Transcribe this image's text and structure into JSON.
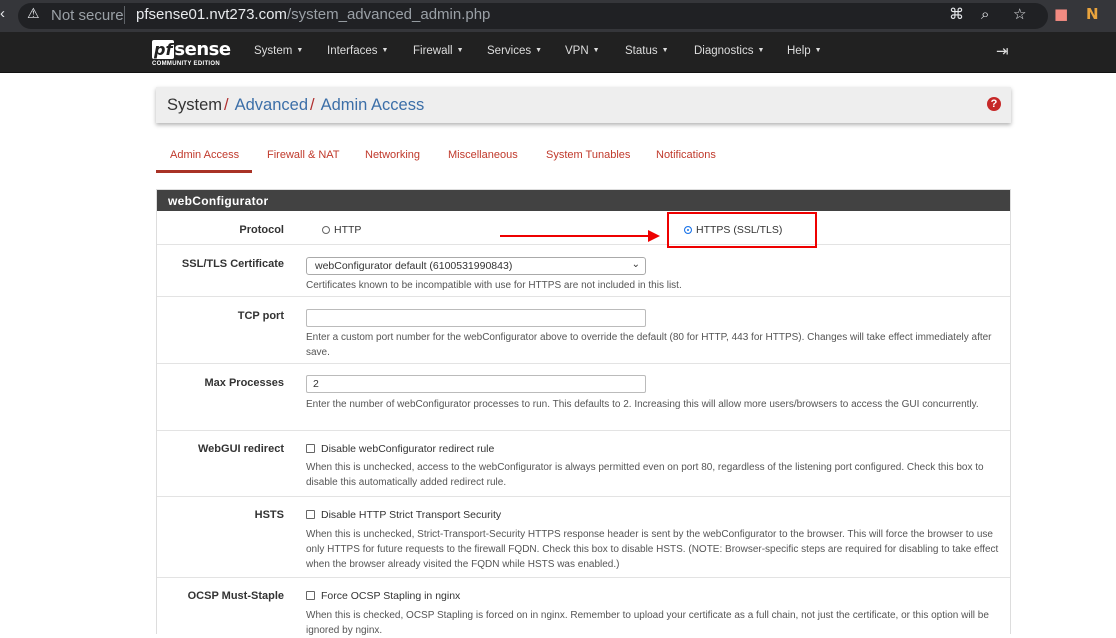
{
  "browser": {
    "security": "Not secure",
    "host": "pfsense01.nvt273.com",
    "path": "/system_advanced_admin.php"
  },
  "brand": {
    "pf": "pf",
    "sense": "sense",
    "edition": "COMMUNITY EDITION"
  },
  "nav": {
    "items": [
      "System",
      "Interfaces",
      "Firewall",
      "Services",
      "VPN",
      "Status",
      "Diagnostics",
      "Help"
    ]
  },
  "breadcrumb": {
    "root": "System",
    "sep": "/",
    "mid": "Advanced",
    "leaf": "Admin Access",
    "help": "?"
  },
  "tabs": [
    "Admin Access",
    "Firewall & NAT",
    "Networking",
    "Miscellaneous",
    "System Tunables",
    "Notifications"
  ],
  "section_title": "webConfigurator",
  "rows": {
    "protocol": {
      "label": "Protocol",
      "opt1": "HTTP",
      "opt2": "HTTPS (SSL/TLS)"
    },
    "cert": {
      "label": "SSL/TLS Certificate",
      "value": "webConfigurator default (6100531990843)",
      "help": "Certificates known to be incompatible with use for HTTPS are not included in this list."
    },
    "tcp": {
      "label": "TCP port",
      "value": "",
      "help": "Enter a custom port number for the webConfigurator above to override the default (80 for HTTP, 443 for HTTPS). Changes will take effect immediately after save."
    },
    "maxproc": {
      "label": "Max Processes",
      "value": "2",
      "help": "Enter the number of webConfigurator processes to run. This defaults to 2. Increasing this will allow more users/browsers to access the GUI concurrently."
    },
    "redirect": {
      "label": "WebGUI redirect",
      "check": "Disable webConfigurator redirect rule",
      "help": "When this is unchecked, access to the webConfigurator is always permitted even on port 80, regardless of the listening port configured. Check this box to disable this automatically added redirect rule."
    },
    "hsts": {
      "label": "HSTS",
      "check": "Disable HTTP Strict Transport Security",
      "help": "When this is unchecked, Strict-Transport-Security HTTPS response header is sent by the webConfigurator to the browser. This will force the browser to use only HTTPS for future requests to the firewall FQDN. Check this box to disable HSTS. (NOTE: Browser-specific steps are required for disabling to take effect when the browser already visited the FQDN while HSTS was enabled.)"
    },
    "ocsp": {
      "label": "OCSP Must-Staple",
      "check": "Force OCSP Stapling in nginx",
      "help": "When this is checked, OCSP Stapling is forced on in nginx. Remember to upload your certificate as a full chain, not just the certificate, or this option will be ignored by nginx."
    }
  }
}
